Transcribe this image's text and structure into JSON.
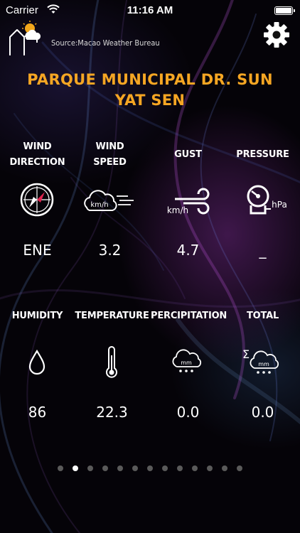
{
  "status_bar": {
    "carrier": "Carrier",
    "time": "11:16 AM",
    "battery_level": 1.0
  },
  "header": {
    "source": "Source:Macao Weather Bureau"
  },
  "station": {
    "name": "PARQUE MUNICIPAL DR. SUN YAT SEN"
  },
  "metrics": [
    {
      "label_line1": "WIND",
      "label_line2": "DIRECTION",
      "value": "ENE",
      "icon": "compass-icon"
    },
    {
      "label_line1": "WIND",
      "label_line2": "SPEED",
      "value": "3.2",
      "icon": "wind-speed-icon",
      "unit": "km/h"
    },
    {
      "label_line1": "GUST",
      "label_line2": "",
      "value": "4.7",
      "icon": "gust-icon",
      "unit": "km/h"
    },
    {
      "label_line1": "PRESSURE",
      "label_line2": "",
      "value": "_",
      "icon": "pressure-gauge-icon",
      "unit": "hPa"
    },
    {
      "label_line1": "HUMIDITY",
      "label_line2": "",
      "value": "86",
      "icon": "droplet-icon"
    },
    {
      "label_line1": "TEMPERATURE",
      "label_line2": "",
      "value": "22.3",
      "icon": "thermometer-icon"
    },
    {
      "label_line1": "PERCIPITATION",
      "label_line2": "",
      "value": "0.0",
      "icon": "rain-cloud-icon",
      "unit": "mm"
    },
    {
      "label_line1": "TOTAL",
      "label_line2": "",
      "value": "0.0",
      "icon": "total-rain-cloud-icon",
      "unit": "mm"
    }
  ],
  "pager": {
    "page_count": 13,
    "active_index": 1
  },
  "colors": {
    "accent": "#f5a623",
    "text": "#ffffff",
    "dot_inactive": "#5a5a5a"
  }
}
